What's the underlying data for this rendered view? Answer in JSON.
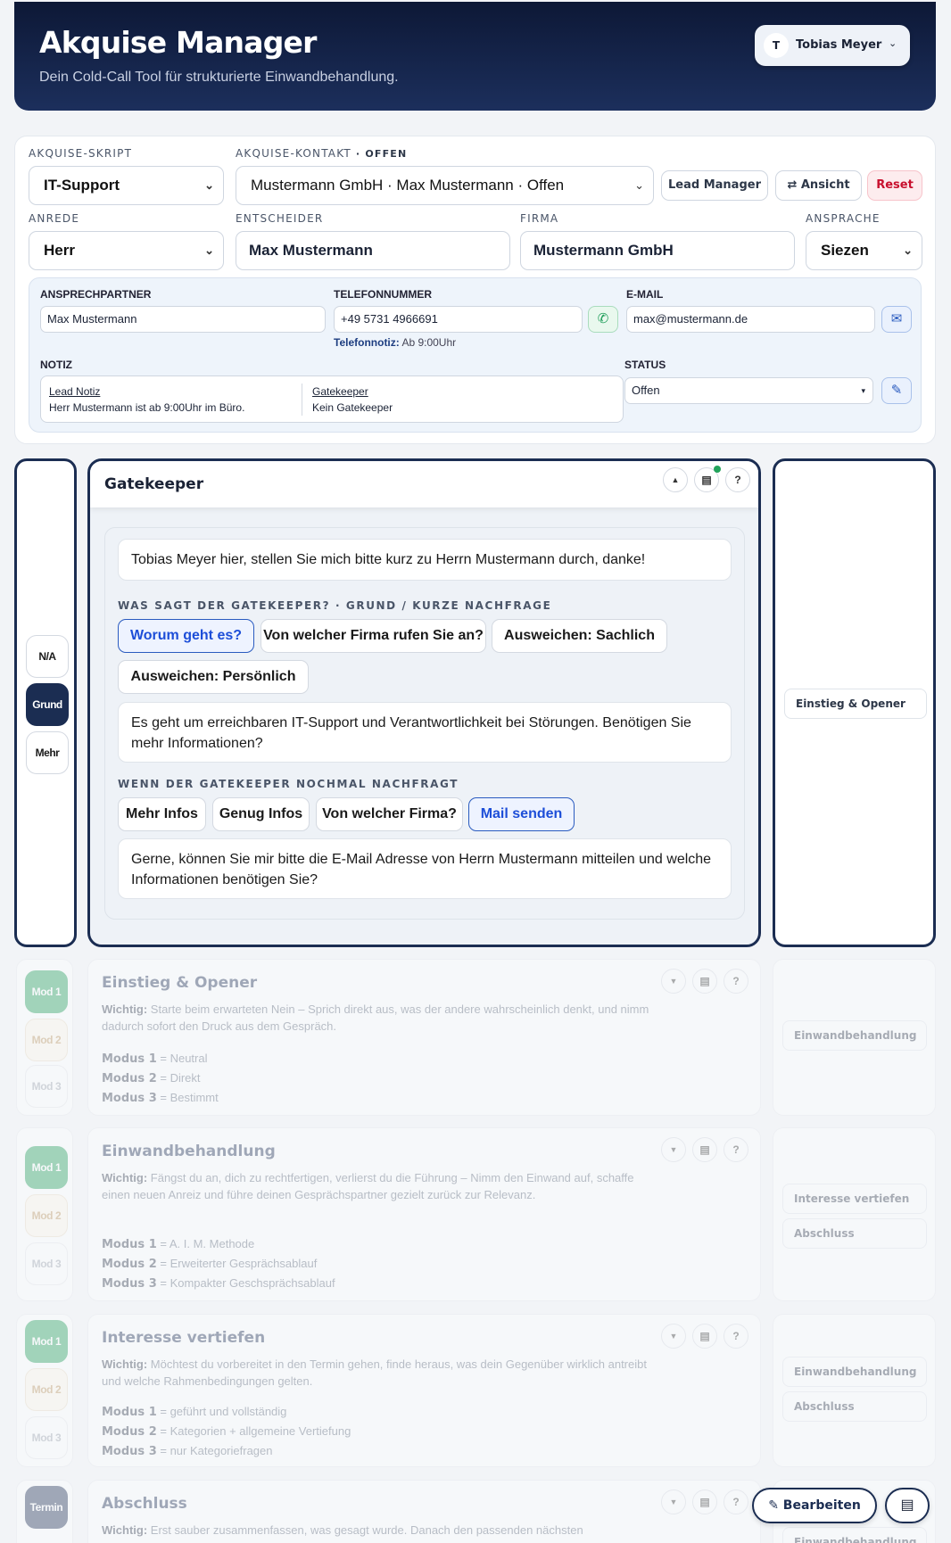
{
  "header": {
    "title": "Akquise Manager",
    "subtitle": "Dein Cold-Call Tool für strukturierte Einwandbehandlung.",
    "user_initial": "T",
    "user_name": "Tobias Meyer"
  },
  "form": {
    "script_label": "AKQUISE-SKRIPT",
    "script_value": "IT-Support",
    "contact_label": "AKQUISE-KONTAKT",
    "contact_status": "· OFFEN",
    "contact_value": "Mustermann GmbH · Max Mustermann · Offen",
    "btn_lead": "Lead Manager",
    "btn_view": "Ansicht",
    "btn_reset": "Reset",
    "anrede_label": "ANREDE",
    "anrede_value": "Herr",
    "entscheider_label": "ENTSCHEIDER",
    "entscheider_value": "Max Mustermann",
    "firma_label": "FIRMA",
    "firma_value": "Mustermann GmbH",
    "ansprache_label": "ANSPRACHE",
    "ansprache_value": "Siezen"
  },
  "details": {
    "contact_label": "ANSPRECHPARTNER",
    "contact_value": "Max Mustermann",
    "phone_label": "TELEFONNUMMER",
    "phone_value": "+49 5731 4966691",
    "phone_note_label": "Telefonnotiz:",
    "phone_note_value": "Ab 9:00Uhr",
    "email_label": "E-MAIL",
    "email_value": "max@mustermann.de",
    "note_label": "NOTIZ",
    "lead_note_title": "Lead Notiz",
    "lead_note_text": "Herr Mustermann ist ab 9:00Uhr im Büro.",
    "gk_note_title": "Gatekeeper",
    "gk_note_text": "Kein Gatekeeper",
    "status_label": "STATUS",
    "status_value": "Offen"
  },
  "gatekeeper": {
    "title": "Gatekeeper",
    "left_pills": [
      "N/A",
      "Grund",
      "Mehr"
    ],
    "right_nav": "Einstieg & Opener",
    "intro": "Tobias Meyer hier, stellen Sie mich bitte kurz zu Herrn Mustermann durch, danke!",
    "q1_label": "WAS SAGT DER GATEKEEPER? · GRUND / KURZE NACHFRAGE",
    "q1_chips": [
      "Worum geht es?",
      "Von welcher Firma rufen Sie an?",
      "Ausweichen: Sachlich",
      "Ausweichen: Persönlich"
    ],
    "answer1": "Es geht um erreichbaren IT-Support und Verantwortlichkeit bei Störungen. Benötigen Sie mehr Informationen?",
    "q2_label": "WENN DER GATEKEEPER NOCHMAL NACHFRAGT",
    "q2_chips": [
      "Mehr Infos",
      "Genug Infos",
      "Von welcher Firma?",
      "Mail senden"
    ],
    "answer2": "Gerne, können Sie mir bitte die E-Mail Adresse von Herrn Mustermann mitteilen und welche Informationen benötigen Sie?"
  },
  "modules": [
    {
      "title": "Einstieg & Opener",
      "wichtig_label": "Wichtig:",
      "wichtig": "Starte beim erwarteten Nein – Sprich direkt aus, was der andere wahrscheinlich denkt, und nimm dadurch sofort den Druck aus dem Gespräch.",
      "modes": [
        {
          "k": "Modus 1",
          "v": "= Neutral"
        },
        {
          "k": "Modus 2",
          "v": "= Direkt"
        },
        {
          "k": "Modus 3",
          "v": "= Bestimmt"
        }
      ],
      "pills": [
        "Mod 1",
        "Mod 2",
        "Mod 3"
      ],
      "nav": [
        "Einwandbehandlung"
      ]
    },
    {
      "title": "Einwandbehandlung",
      "wichtig_label": "Wichtig:",
      "wichtig": "Fängst du an, dich zu rechtfertigen, verlierst du die Führung – Nimm den Einwand auf, schaffe einen neuen Anreiz und führe deinen Gesprächspartner gezielt zurück zur Relevanz.",
      "modes": [
        {
          "k": "Modus 1",
          "v": "= A. I. M. Methode"
        },
        {
          "k": "Modus 2",
          "v": "= Erweiterter Gesprächsablauf"
        },
        {
          "k": "Modus 3",
          "v": "= Kompakter Geschsprächsablauf"
        }
      ],
      "pills": [
        "Mod 1",
        "Mod 2",
        "Mod 3"
      ],
      "nav": [
        "Interesse vertiefen",
        "Abschluss"
      ]
    },
    {
      "title": "Interesse vertiefen",
      "wichtig_label": "Wichtig:",
      "wichtig": "Möchtest du vorbereitet in den Termin gehen, finde heraus, was dein Gegenüber wirklich antreibt und welche Rahmenbedingungen gelten.",
      "modes": [
        {
          "k": "Modus 1",
          "v": "= geführt und vollständig"
        },
        {
          "k": "Modus 2",
          "v": "= Kategorien + allgemeine Vertiefung"
        },
        {
          "k": "Modus 3",
          "v": "= nur Kategoriefragen"
        }
      ],
      "pills": [
        "Mod 1",
        "Mod 2",
        "Mod 3"
      ],
      "nav": [
        "Einwandbehandlung",
        "Abschluss"
      ]
    },
    {
      "title": "Abschluss",
      "wichtig_label": "Wichtig:",
      "wichtig": "Erst sauber zusammenfassen, was gesagt wurde. Danach den passenden nächsten",
      "pills": [
        "Termin"
      ],
      "nav": [
        "Einwandbehandlung"
      ]
    }
  ],
  "floating": {
    "edit_label": "Bearbeiten"
  },
  "colors": {
    "header_bg": "#0d1836",
    "accent_navy": "#1b2d52",
    "reset_red": "#c8102e",
    "link_blue": "#1d4ed8",
    "mod_green": "#1f9e5a"
  }
}
